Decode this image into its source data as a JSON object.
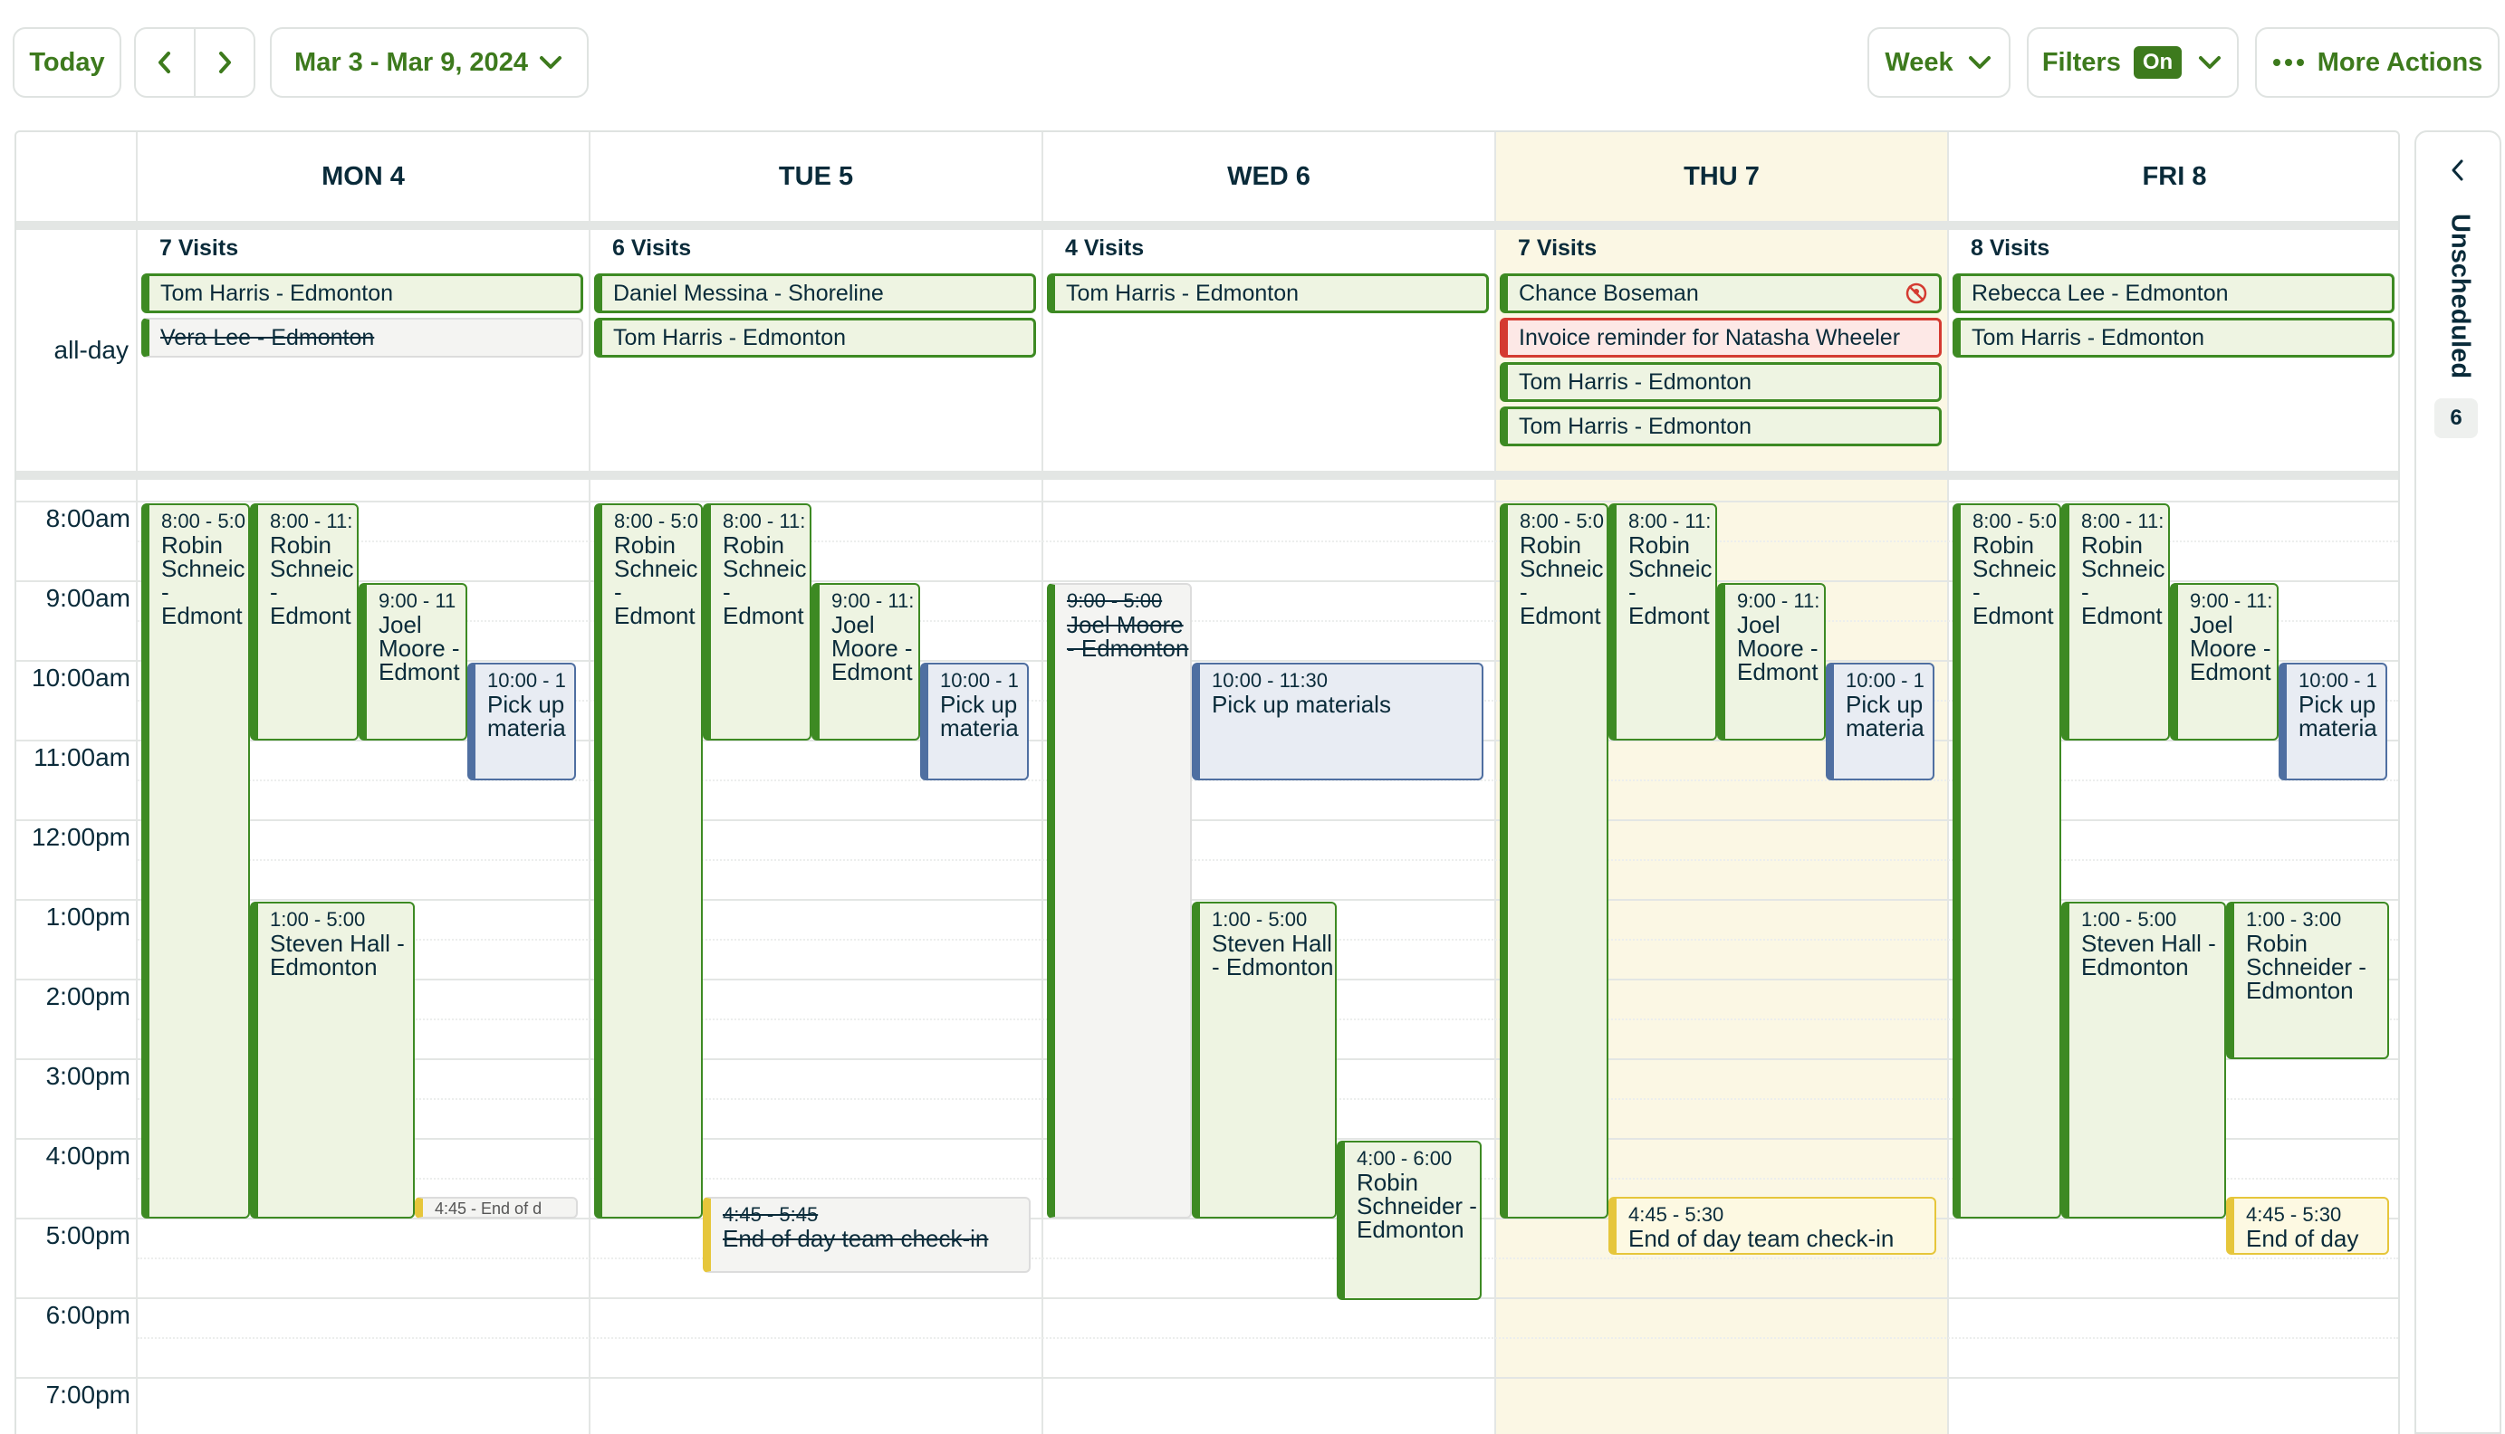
{
  "toolbar": {
    "today_label": "Today",
    "date_range": "Mar 3 - Mar 9, 2024",
    "view_label": "Week",
    "filters_label": "Filters",
    "filters_badge": "On",
    "more_actions_label": "More Actions",
    "accent_color": "#3d7a1d"
  },
  "days": [
    {
      "label": "MON 4",
      "visits": "7 Visits"
    },
    {
      "label": "TUE 5",
      "visits": "6 Visits"
    },
    {
      "label": "WED 6",
      "visits": "4 Visits"
    },
    {
      "label": "THU 7",
      "visits": "7 Visits"
    },
    {
      "label": "FRI 8",
      "visits": "8 Visits"
    }
  ],
  "all_day_label": "all-day",
  "all_day": [
    {
      "day": "MON 4",
      "text": "Tom Harris - Edmonton"
    },
    {
      "day": "MON 4",
      "text": "Vera Lee - Edmonton",
      "status": "cancelled"
    },
    {
      "day": "TUE 5",
      "text": "Daniel Messina - Shoreline"
    },
    {
      "day": "TUE 5",
      "text": "Tom Harris - Edmonton"
    },
    {
      "day": "WED 6",
      "text": "Tom Harris - Edmonton"
    },
    {
      "day": "THU 7",
      "text": "Chance Boseman",
      "icon": "unscheduled-assignee-icon"
    },
    {
      "day": "THU 7",
      "text": "Invoice reminder for Natasha Wheeler",
      "type": "invoice"
    },
    {
      "day": "THU 7",
      "text": "Tom Harris - Edmonton"
    },
    {
      "day": "THU 7",
      "text": "Tom Harris - Edmonton"
    },
    {
      "day": "FRI 8",
      "text": "Rebecca Lee - Edmonton"
    },
    {
      "day": "FRI 8",
      "text": "Tom Harris - Edmonton"
    }
  ],
  "time_labels": [
    "8:00am",
    "9:00am",
    "10:00am",
    "11:00am",
    "12:00pm",
    "1:00pm",
    "2:00pm",
    "3:00pm",
    "4:00pm",
    "5:00pm",
    "6:00pm",
    "7:00pm"
  ],
  "events": {
    "mon": [
      {
        "time": "8:00 - 5:0",
        "name": "Robin Schneic - Edmont"
      },
      {
        "time": "8:00 - 11:",
        "name": "Robin Schneic - Edmont"
      },
      {
        "time": "9:00 - 11",
        "name": "Joel Moore - Edmont"
      },
      {
        "time": "10:00 - 1",
        "name": "Pick up materia"
      },
      {
        "time": "1:00 - 5:00",
        "name": "Steven Hall - Edmonton"
      },
      {
        "time": "4:45 - End of d",
        "name": ""
      }
    ],
    "tue": [
      {
        "time": "8:00 - 5:0",
        "name": "Robin Schneic - Edmont"
      },
      {
        "time": "8:00 - 11:",
        "name": "Robin Schneic - Edmont"
      },
      {
        "time": "9:00 - 11:",
        "name": "Joel Moore - Edmont"
      },
      {
        "time": "10:00 - 1",
        "name": "Pick up materia"
      },
      {
        "time": "4:45 - 5:45",
        "name": "End of day team check-in"
      }
    ],
    "wed": [
      {
        "time": "9:00 - 5:00",
        "name": "Joel Moore - Edmonton"
      },
      {
        "time": "10:00 - 11:30",
        "name": "Pick up materials"
      },
      {
        "time": "1:00 - 5:00",
        "name": "Steven Hall - Edmonton"
      },
      {
        "time": "4:00 - 6:00",
        "name": "Robin Schneider - Edmonton"
      }
    ],
    "thu": [
      {
        "time": "8:00 - 5:0",
        "name": "Robin Schneic - Edmont"
      },
      {
        "time": "8:00 - 11:",
        "name": "Robin Schneic - Edmont"
      },
      {
        "time": "9:00 - 11:",
        "name": "Joel Moore - Edmont"
      },
      {
        "time": "10:00 - 1",
        "name": "Pick up materia"
      },
      {
        "time": "4:45 - 5:30",
        "name": "End of day team check-in"
      }
    ],
    "fri": [
      {
        "time": "8:00 - 5:0",
        "name": "Robin Schneic - Edmont"
      },
      {
        "time": "8:00 - 11:",
        "name": "Robin Schneic - Edmont"
      },
      {
        "time": "9:00 - 11:",
        "name": "Joel Moore - Edmont"
      },
      {
        "time": "10:00 - 1",
        "name": "Pick up materia"
      },
      {
        "time": "1:00 - 5:00",
        "name": "Steven Hall - Edmonton"
      },
      {
        "time": "1:00 - 3:00",
        "name": "Robin Schneider - Edmonton"
      },
      {
        "time": "4:45 - 5:30",
        "name": "End of day"
      }
    ]
  },
  "side_panel": {
    "label": "Unscheduled",
    "count": "6"
  }
}
